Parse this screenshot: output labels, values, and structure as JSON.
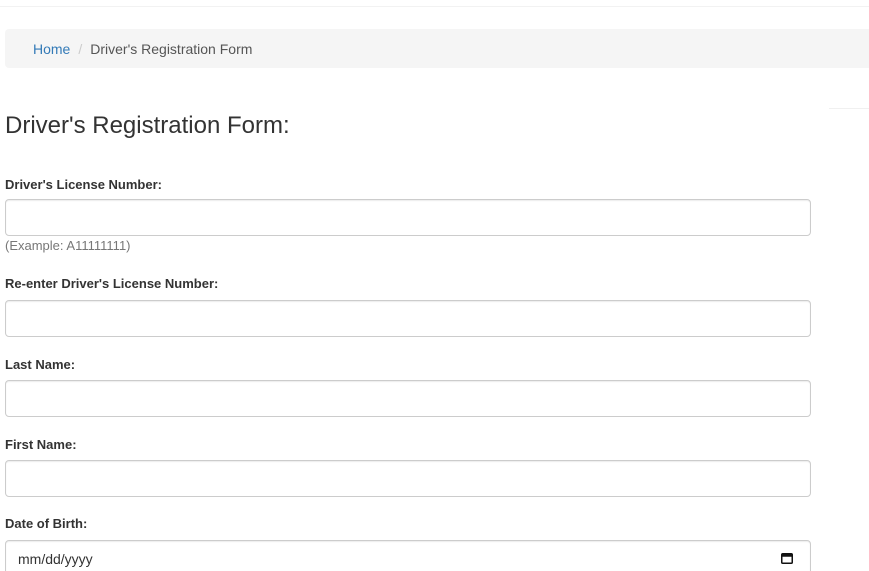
{
  "breadcrumb": {
    "home_label": "Home",
    "separator": "/",
    "current_label": "Driver's Registration Form"
  },
  "page": {
    "title": "Driver's Registration Form:"
  },
  "form": {
    "license_number": {
      "label": "Driver's License Number:",
      "value": "",
      "help": "(Example: A11111111)"
    },
    "license_number_confirm": {
      "label": "Re-enter Driver's License Number:",
      "value": ""
    },
    "last_name": {
      "label": "Last Name:",
      "value": ""
    },
    "first_name": {
      "label": "First Name:",
      "value": ""
    },
    "date_of_birth": {
      "label": "Date of Birth:",
      "placeholder": "mm/dd/yyyy",
      "icon": "calendar-icon"
    }
  },
  "colors": {
    "link": "#337ab7",
    "breadcrumb_bg": "#f5f5f5",
    "input_border": "#cccccc",
    "help_text": "#777777"
  }
}
